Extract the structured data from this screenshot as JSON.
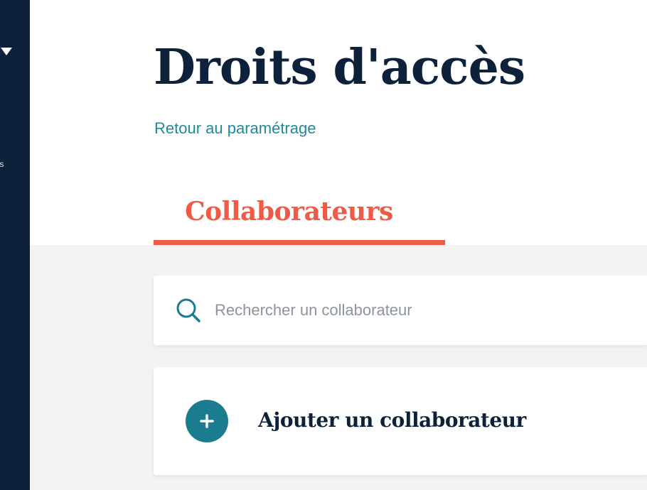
{
  "sidebar": {
    "toggle_icon": "caret-down-icon",
    "item_label_partial": "ts"
  },
  "header": {
    "title": "Droits d'accès",
    "back_link": "Retour au paramétrage"
  },
  "tabs": [
    {
      "label": "Collaborateurs",
      "active": true
    }
  ],
  "search": {
    "icon": "search-icon",
    "placeholder": "Rechercher un collaborateur",
    "value": ""
  },
  "add": {
    "icon": "plus-icon",
    "label": "Ajouter un collaborateur"
  },
  "colors": {
    "navy": "#0d213a",
    "teal": "#1b7c8f",
    "link": "#1f8a9c",
    "accent": "#ef5b45",
    "panel_bg": "#f3f3f4"
  }
}
